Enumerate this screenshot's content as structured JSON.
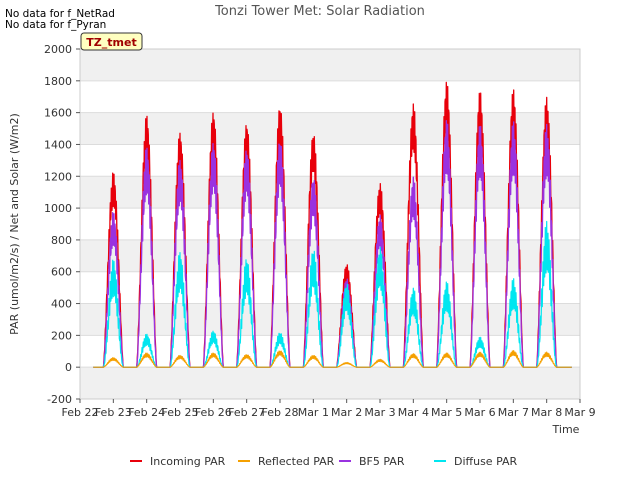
{
  "notes": [
    "No data for f_NetRad",
    "No data for f_Pyran"
  ],
  "chart_data": {
    "type": "line",
    "title": "Tonzi Tower Met: Solar Radiation",
    "xlabel": "Time",
    "ylabel": "PAR (umol/m2/s) / Net and Solar (W/m2)",
    "badge": "TZ_tmet",
    "ylim": [
      -200,
      2000
    ],
    "yticks": [
      -200,
      0,
      200,
      400,
      600,
      800,
      1000,
      1200,
      1400,
      1600,
      1800,
      2000
    ],
    "xlim": [
      0,
      15
    ],
    "xticks": [
      0,
      1,
      2,
      3,
      4,
      5,
      6,
      7,
      8,
      9,
      10,
      11,
      12,
      13,
      14,
      15
    ],
    "xtick_labels": [
      "Feb 22",
      "Feb 23",
      "Feb 24",
      "Feb 25",
      "Feb 26",
      "Feb 27",
      "Feb 28",
      "Mar 1",
      "Mar 2",
      "Mar 3",
      "Mar 4",
      "Mar 5",
      "Mar 6",
      "Mar 7",
      "Mar 8",
      "Mar 9"
    ],
    "grid": true,
    "legend_position": "bottom",
    "days": [
      1,
      2,
      3,
      4,
      5,
      6,
      7,
      8,
      9,
      10,
      11,
      12,
      13,
      14
    ],
    "series": [
      {
        "name": "Incoming PAR",
        "color": "#e8000b",
        "values": [
          1230,
          1590,
          1480,
          1610,
          1540,
          1650,
          1480,
          650,
          1160,
          1660,
          1800,
          1740,
          1750,
          1700
        ]
      },
      {
        "name": "Reflected PAR",
        "color": "#f5a000",
        "values": [
          60,
          90,
          75,
          90,
          80,
          105,
          75,
          30,
          50,
          85,
          90,
          95,
          105,
          95
        ]
      },
      {
        "name": "BF5 PAR",
        "color": "#9932e0",
        "values": [
          980,
          1390,
          1310,
          1420,
          1380,
          1440,
          1200,
          560,
          960,
          1200,
          1560,
          1530,
          1550,
          1530
        ]
      },
      {
        "name": "Diffuse PAR",
        "color": "#00e6f0",
        "values": [
          680,
          210,
          730,
          230,
          690,
          220,
          750,
          530,
          760,
          500,
          540,
          190,
          560,
          920
        ]
      }
    ]
  }
}
